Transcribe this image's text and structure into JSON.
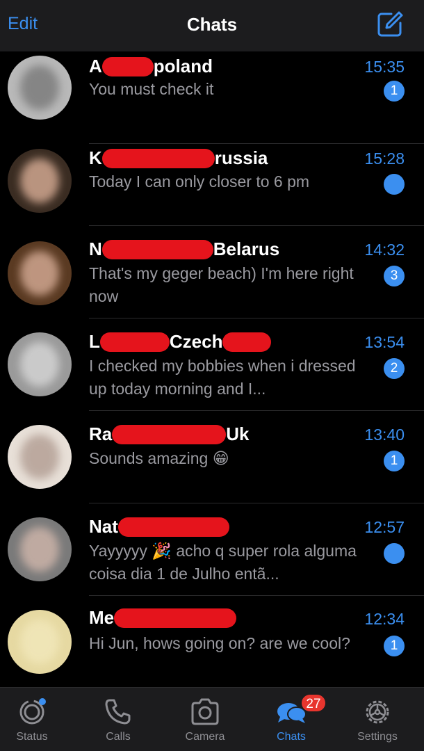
{
  "header": {
    "edit_label": "Edit",
    "title": "Chats",
    "compose_icon": "compose-icon"
  },
  "chats": [
    {
      "name_prefix": "A",
      "name_suffix": "poland",
      "time": "15:35",
      "preview": "You must check it",
      "badge": "1"
    },
    {
      "name_prefix": "K",
      "name_suffix": "russia",
      "time": "15:28",
      "preview": "Today I can only closer to 6 pm",
      "badge": ""
    },
    {
      "name_prefix": "N",
      "name_suffix": "Belarus",
      "time": "14:32",
      "preview": "That's my geger beach) I'm here right now",
      "badge": "3"
    },
    {
      "name_prefix": "L",
      "name_suffix": "Czech",
      "time": "13:54",
      "preview": "I checked my bobbies when i dressed up today morning and I...",
      "badge": "2"
    },
    {
      "name_prefix": "Ra",
      "name_suffix": "Uk",
      "time": "13:40",
      "preview": "Sounds amazing 😁",
      "badge": "1"
    },
    {
      "name_prefix": "Nat",
      "name_suffix": "",
      "time": "12:57",
      "preview": "Yayyyyy 🎉 acho q super rola alguma coisa dia 1 de Julho entã...",
      "badge": ""
    },
    {
      "name_prefix": "Me",
      "name_suffix": "",
      "time": "12:34",
      "preview": "Hi Jun, hows going on? are we cool?",
      "badge": "1"
    }
  ],
  "tabs": [
    {
      "label": "Status",
      "icon": "status-icon"
    },
    {
      "label": "Calls",
      "icon": "phone-icon"
    },
    {
      "label": "Camera",
      "icon": "camera-icon"
    },
    {
      "label": "Chats",
      "icon": "chat-bubbles-icon",
      "badge": "27"
    },
    {
      "label": "Settings",
      "icon": "gear-icon"
    }
  ],
  "colors": {
    "accent": "#3b8ff0",
    "redaction": "#e5141c",
    "badge_red": "#e8352e"
  }
}
